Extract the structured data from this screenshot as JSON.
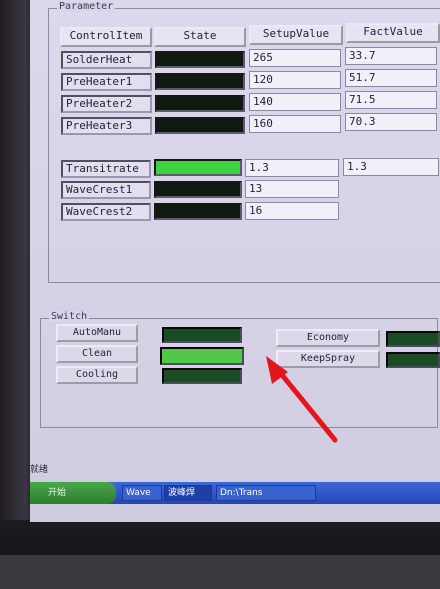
{
  "parameter": {
    "title": "Parameter",
    "headers": [
      "ControlItem",
      "State",
      "SetupValue",
      "FactValue"
    ],
    "rows": [
      {
        "name": "SolderHeat",
        "state": "off",
        "setup": "265",
        "fact": "33.7"
      },
      {
        "name": "PreHeater1",
        "state": "off",
        "setup": "120",
        "fact": "51.7"
      },
      {
        "name": "PreHeater2",
        "state": "off",
        "setup": "140",
        "fact": "71.5"
      },
      {
        "name": "PreHeater3",
        "state": "off",
        "setup": "160",
        "fact": "70.3"
      }
    ],
    "rows2": [
      {
        "name": "Transitrate",
        "state": "on",
        "setup": "1.3",
        "fact": "1.3"
      },
      {
        "name": "WaveCrest1",
        "state": "off",
        "setup": "13",
        "fact": ""
      },
      {
        "name": "WaveCrest2",
        "state": "off",
        "setup": "16",
        "fact": ""
      }
    ]
  },
  "switch": {
    "title": "Switch",
    "left": [
      {
        "label": "AutoManu",
        "state": "off"
      },
      {
        "label": "Clean",
        "state": "on"
      },
      {
        "label": "Cooling",
        "state": "off"
      }
    ],
    "right": [
      {
        "label": "Economy",
        "state": "off"
      },
      {
        "label": "KeepSpray",
        "state": "off"
      }
    ]
  },
  "status_bar": {
    "text": "就绪"
  },
  "taskbar": {
    "start_label": "开始",
    "items": [
      {
        "label": "Wave"
      },
      {
        "label": "波峰焊"
      },
      {
        "label": "Dn:\\Trans"
      }
    ]
  }
}
